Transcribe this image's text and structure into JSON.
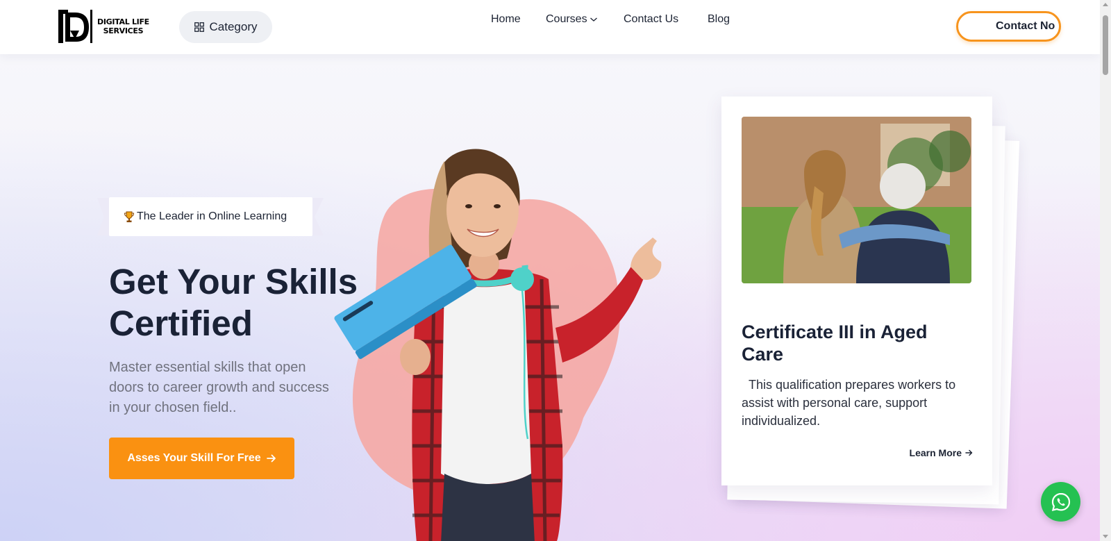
{
  "header": {
    "logo_line1": "DIGITAL LIFE",
    "logo_line2": "SERVICES",
    "category_label": "Category",
    "nav": {
      "home": "Home",
      "courses": "Courses",
      "contact": "Contact Us",
      "blog": "Blog"
    },
    "contact_now_label": "Contact No"
  },
  "hero": {
    "badge_text": "The Leader in Online Learning",
    "title_line1": "Get Your Skills",
    "title_line2": "Certified",
    "subtitle": "Master essential skills that open doors to career growth and success in your chosen field..",
    "cta_label": "Asses Your Skill For Free"
  },
  "course_card": {
    "title": "Certificate III in Aged Care",
    "description": "  This qualification prepares workers to assist with personal care, support individualized.",
    "link_label": "Learn More"
  },
  "colors": {
    "accent": "#fa9111",
    "whatsapp": "#25c152",
    "dark_text": "#1a2236"
  },
  "icons": {
    "category": "grid-icon",
    "courses_dropdown": "chevron-down-icon",
    "badge": "trophy-icon",
    "cta": "arrow-right-icon",
    "card_link": "arrow-right-icon",
    "chat": "whatsapp-icon"
  }
}
